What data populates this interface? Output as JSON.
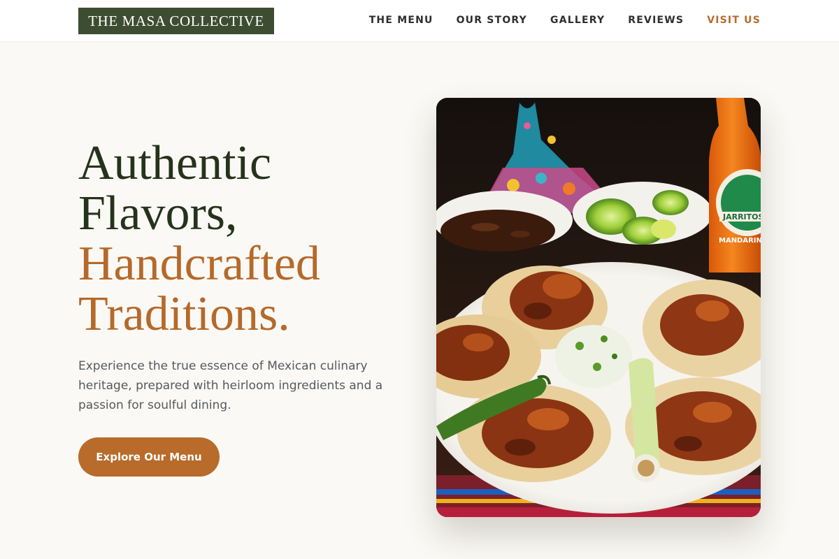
{
  "header": {
    "logo": "THE MASA COLLECTIVE",
    "nav": [
      {
        "label": "THE MENU"
      },
      {
        "label": "OUR STORY"
      },
      {
        "label": "GALLERY"
      },
      {
        "label": "REVIEWS"
      },
      {
        "label": "VISIT US"
      }
    ]
  },
  "hero": {
    "headline": {
      "line1": "Authentic",
      "line2": "Flavors,",
      "line3": "Handcrafted",
      "line4": "Traditions."
    },
    "description": "Experience the true essence of Mexican culinary heritage, prepared with heirloom ingredients and a passion for soulful dining.",
    "cta_label": "Explore Our Menu",
    "image": {
      "subject": "plate of tacos with salsa, limes, chiles and a soda bottle",
      "bottle_label": "JARRITOS",
      "bottle_flavor": "MANDARIN"
    }
  },
  "colors": {
    "background": "#faf9f5",
    "logo_bg": "#3d4d31",
    "headline_dark": "#26331c",
    "accent": "#b86b2a",
    "nav_accent": "#b86b2a"
  }
}
